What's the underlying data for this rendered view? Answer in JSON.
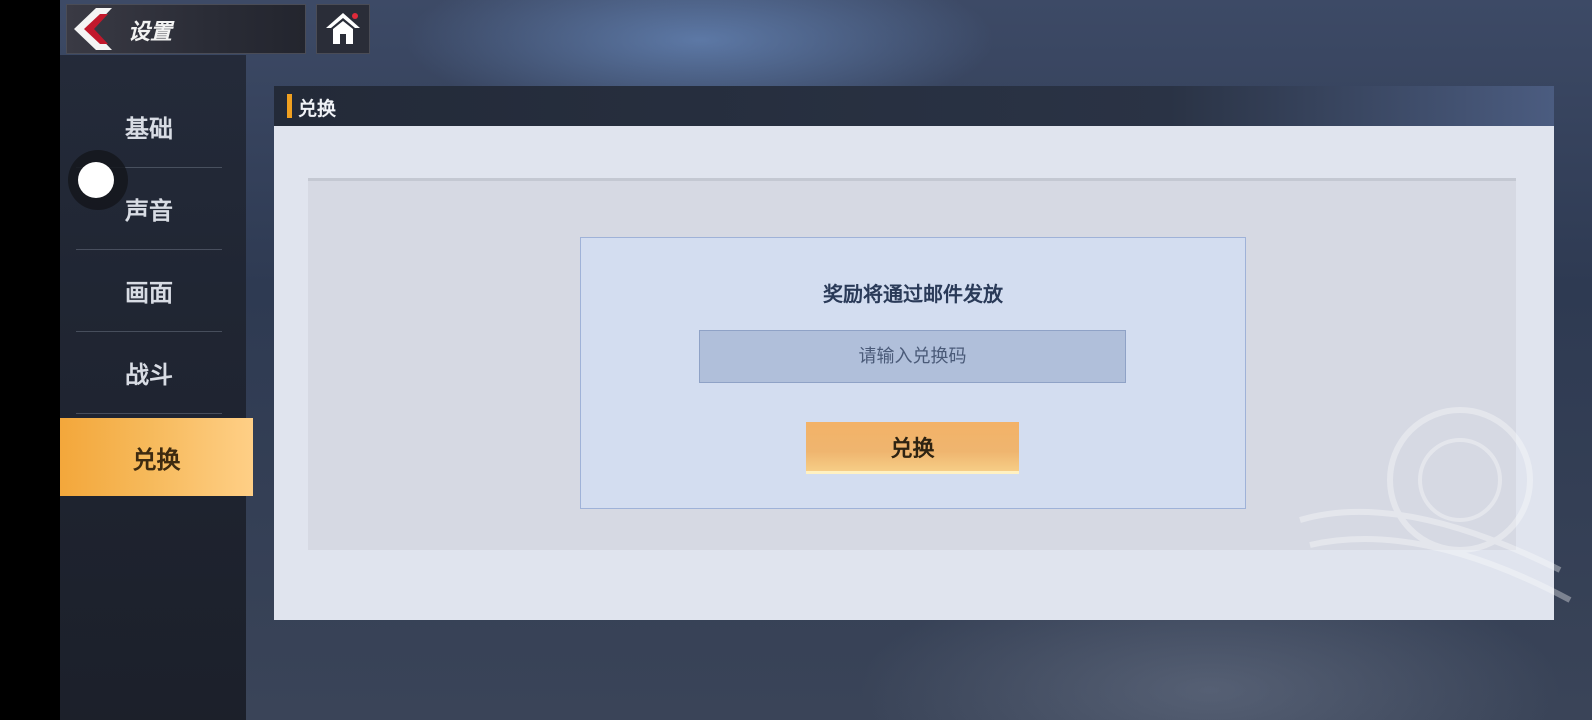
{
  "header": {
    "title": "设置"
  },
  "sidebar": {
    "items": [
      {
        "label": "基础"
      },
      {
        "label": "声音"
      },
      {
        "label": "画面"
      },
      {
        "label": "战斗"
      },
      {
        "label": "兑换"
      }
    ],
    "active_index": 4
  },
  "panel": {
    "title": "兑换"
  },
  "redeem": {
    "note": "奖励将通过邮件发放",
    "placeholder": "请输入兑换码",
    "value": "",
    "button_label": "兑换"
  },
  "colors": {
    "accent": "#f0a020",
    "active_tab": "#f6b95a",
    "button": "#efb56f"
  },
  "icons": [
    "back-arrow-icon",
    "home-icon"
  ]
}
